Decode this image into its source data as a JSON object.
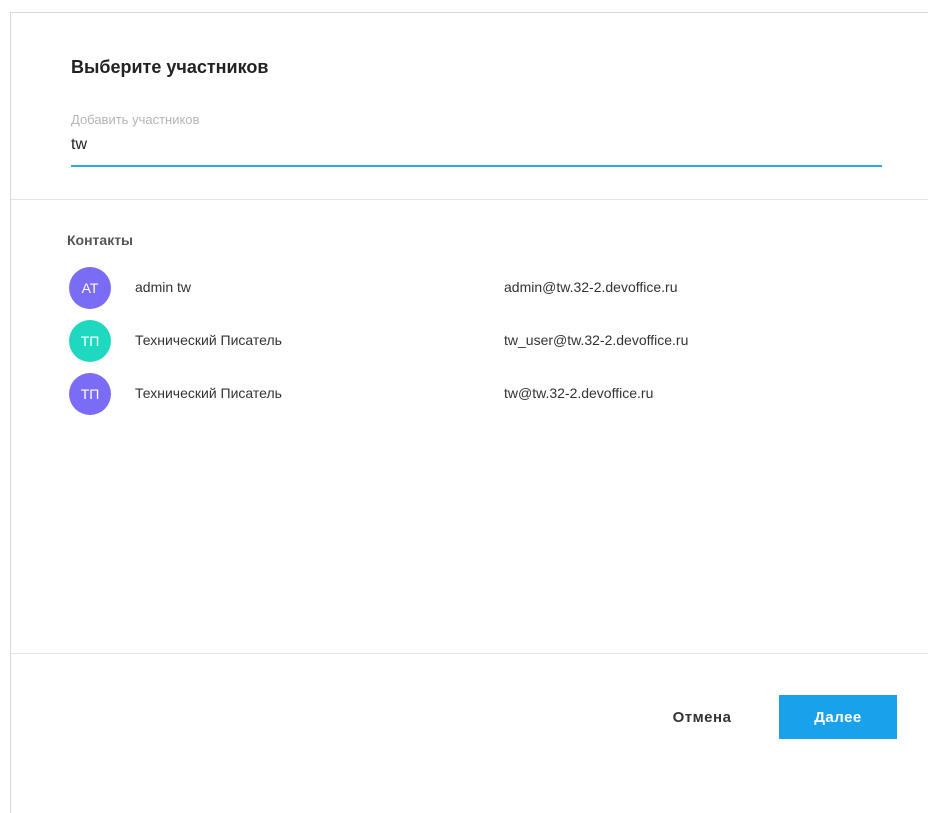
{
  "dialog": {
    "title": "Выберите участников",
    "participants_field": {
      "label": "Добавить участников",
      "value": "tw"
    },
    "contacts_heading": "Контакты",
    "contacts": [
      {
        "initials": "AT",
        "name": "admin tw",
        "email": "admin@tw.32-2.devoffice.ru",
        "avatar_color": "#7b6cf6"
      },
      {
        "initials": "ТП",
        "name": "Технический Писатель",
        "email": "tw_user@tw.32-2.devoffice.ru",
        "avatar_color": "#1ed8c0"
      },
      {
        "initials": "ТП",
        "name": "Технический Писатель",
        "email": "tw@tw.32-2.devoffice.ru",
        "avatar_color": "#7b6cf6"
      }
    ],
    "cancel_label": "Отмена",
    "next_label": "Далее"
  },
  "colors": {
    "accent": "#1aa1ec",
    "underline": "#2aa8e8"
  }
}
